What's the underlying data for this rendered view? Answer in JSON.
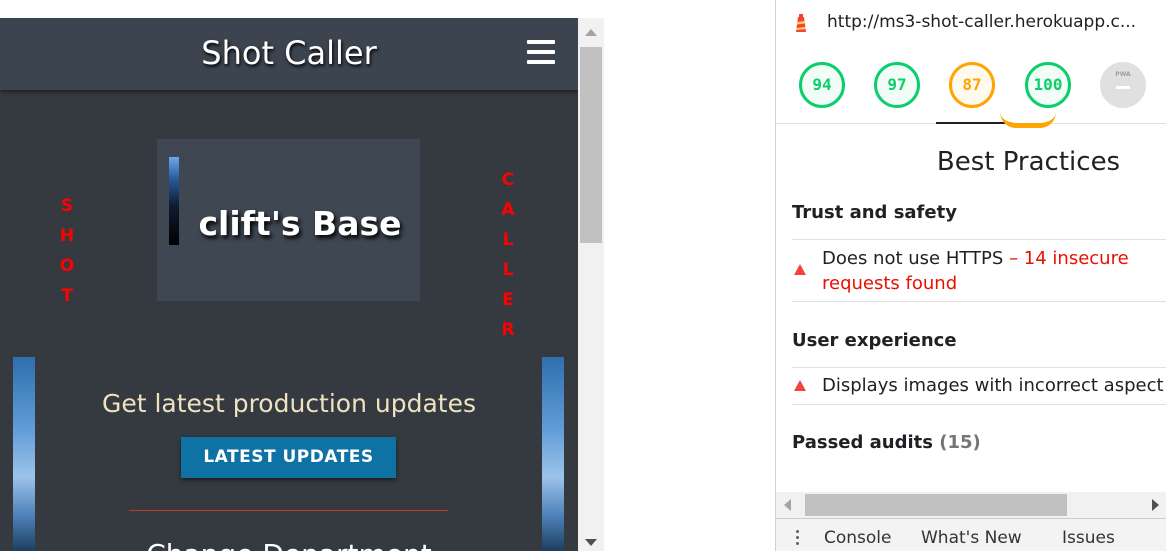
{
  "site": {
    "brand": "Shot Caller",
    "left_word": [
      "S",
      "H",
      "O",
      "T"
    ],
    "right_word": [
      "C",
      "A",
      "L",
      "L",
      "E",
      "R"
    ],
    "base_title": "clift's Base",
    "updates_text": "Get latest production updates",
    "updates_button": "LATEST UPDATES",
    "next_heading": "Change Department",
    "colors": {
      "navbar": "#3c4450",
      "body": "#343a40",
      "side_word": "#ff0000",
      "button": "#0f72a4",
      "divider": "#c0392b"
    }
  },
  "lighthouse": {
    "url": "http://ms3-shot-caller.herokuapp.c...",
    "scores": [
      {
        "label": "94",
        "status": "pass"
      },
      {
        "label": "97",
        "status": "pass"
      },
      {
        "label": "87",
        "status": "average"
      },
      {
        "label": "100",
        "status": "pass"
      },
      {
        "label": "PWA",
        "status": "not-applicable"
      }
    ],
    "pwa_dash": "–",
    "category_title": "Best Practices",
    "groups": {
      "trust": {
        "title": "Trust and safety",
        "audit_title": "Does not use HTTPS",
        "audit_warning": "– 14 insecure requests found"
      },
      "ux": {
        "title": "User experience",
        "audit_title": "Displays images with incorrect aspect ratio"
      },
      "passed": {
        "title": "Passed audits",
        "count": "(15)"
      }
    },
    "drawer_tabs": [
      "Console",
      "What's New",
      "Issues"
    ],
    "colors": {
      "pass": "#0cce6b",
      "average": "#ffa400",
      "fail": "#f4433c",
      "warning_text": "#eb0f00"
    }
  }
}
